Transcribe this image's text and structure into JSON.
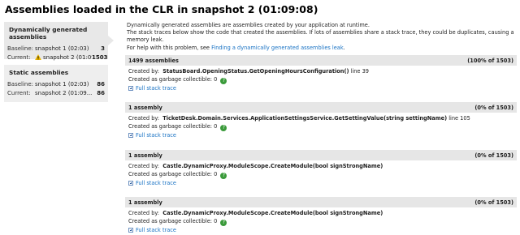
{
  "page": {
    "title": "Assemblies loaded in the CLR in snapshot 2 (01:09:08)"
  },
  "left_panels": {
    "dynamic": {
      "heading": "Dynamically generated assemblies",
      "baseline_label": "Baseline:",
      "baseline_snapshot": "snapshot 1 (02:03)",
      "baseline_count": "3",
      "current_label": "Current:",
      "current_snapshot": "snapshot 2 (01:09...",
      "current_count": "1503",
      "warning_icon": "warning-icon"
    },
    "static": {
      "heading": "Static assemblies",
      "baseline_label": "Baseline:",
      "baseline_snapshot": "snapshot 1 (02:03)",
      "baseline_count": "86",
      "current_label": "Current:",
      "current_snapshot": "snapshot 2 (01:09...",
      "current_count": "86"
    }
  },
  "intro": {
    "line1": "Dynamically generated assemblies are assemblies created by your application at runtime.",
    "line2": "The stack traces below show the code that created the assemblies. If lots of assemblies share a stack trace, they could be duplicates, causing a memory leak.",
    "line3_prefix": "For help with this problem, see ",
    "link_text": "Finding a dynamically generated assemblies leak",
    "line3_suffix": "."
  },
  "groups": [
    {
      "count": "1499 assemblies",
      "percent": "(100% of 1503)",
      "created_by_label": "Created by:",
      "method": "StatusBoard.OpeningStatus.GetOpeningHoursConfiguration()",
      "line_info": " line 39",
      "gc_label": "Created as garbage collectible: 0",
      "link": "Full stack trace"
    },
    {
      "count": "1 assembly",
      "percent": "(0% of 1503)",
      "created_by_label": "Created by:",
      "method": "TicketDesk.Domain.Services.ApplicationSettingsService.GetSettingValue(string settingName)",
      "line_info": " line 105",
      "gc_label": "Created as garbage collectible: 0",
      "link": "Full stack trace"
    },
    {
      "count": "1 assembly",
      "percent": "(0% of 1503)",
      "created_by_label": "Created by:",
      "method": "Castle.DynamicProxy.ModuleScope.CreateModule(bool signStrongName)",
      "line_info": "",
      "gc_label": "Created as garbage collectible: 0",
      "link": "Full stack trace"
    },
    {
      "count": "1 assembly",
      "percent": "(0% of 1503)",
      "created_by_label": "Created by:",
      "method": "Castle.DynamicProxy.ModuleScope.CreateModule(bool signStrongName)",
      "line_info": "",
      "gc_label": "Created as garbage collectible: 0",
      "link": "Full stack trace"
    }
  ],
  "gc_badge_glyph": "?",
  "colors": {
    "link": "#1a73c4",
    "badge": "#3a9a3a",
    "warning": "#e8b400"
  }
}
